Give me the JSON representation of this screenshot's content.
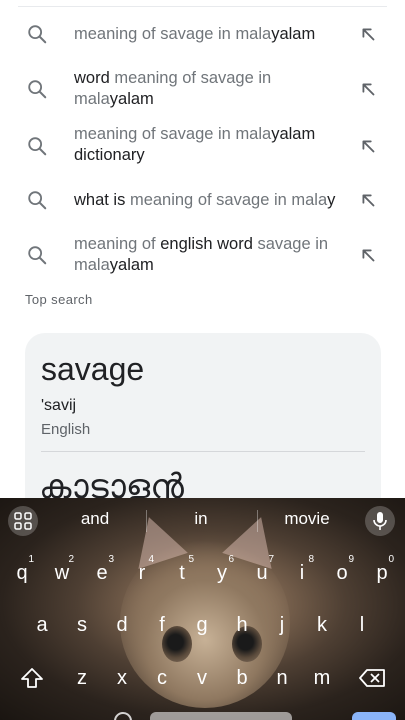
{
  "suggestions": [
    {
      "parts": [
        {
          "t": "meaning of savage in mala",
          "bold": false
        },
        {
          "t": "yalam",
          "bold": true
        }
      ]
    },
    {
      "parts": [
        {
          "t": "word",
          "bold": true
        },
        {
          "t": " meaning of savage in mala",
          "bold": false
        },
        {
          "t": "yalam",
          "bold": true
        }
      ]
    },
    {
      "parts": [
        {
          "t": "meaning of savage in mala",
          "bold": false
        },
        {
          "t": "yalam",
          "bold": true
        },
        {
          "t": " dictionary",
          "bold": true
        }
      ]
    },
    {
      "parts": [
        {
          "t": "what is",
          "bold": true
        },
        {
          "t": " meaning of savage in mala",
          "bold": false
        },
        {
          "t": "y",
          "bold": true
        }
      ]
    },
    {
      "parts": [
        {
          "t": "meaning of ",
          "bold": false
        },
        {
          "t": "english word",
          "bold": true
        },
        {
          "t": " savage in mala",
          "bold": false
        },
        {
          "t": "yalam",
          "bold": true
        }
      ]
    }
  ],
  "top_search_label": "Top search",
  "card": {
    "word": "savage",
    "phonetic": "'savij",
    "language": "English",
    "translation": "കാടാളൻ"
  },
  "keyboard": {
    "suggestions": [
      "and",
      "in",
      "movie"
    ],
    "row1": [
      {
        "k": "q",
        "n": "1"
      },
      {
        "k": "w",
        "n": "2"
      },
      {
        "k": "e",
        "n": "3"
      },
      {
        "k": "r",
        "n": "4"
      },
      {
        "k": "t",
        "n": "5"
      },
      {
        "k": "y",
        "n": "6"
      },
      {
        "k": "u",
        "n": "7"
      },
      {
        "k": "i",
        "n": "8"
      },
      {
        "k": "o",
        "n": "9"
      },
      {
        "k": "p",
        "n": "0"
      }
    ],
    "row2": [
      "a",
      "s",
      "d",
      "f",
      "g",
      "h",
      "j",
      "k",
      "l"
    ],
    "row3": [
      "z",
      "x",
      "c",
      "v",
      "b",
      "n",
      "m"
    ],
    "icons": {
      "grid": "apps-grid-icon",
      "mic": "microphone-icon",
      "shift": "shift-icon",
      "backspace": "backspace-icon"
    }
  },
  "colors": {
    "accent_blue": "#8ab4f8",
    "muted_text": "#70757a",
    "card_bg": "#f1f3f4"
  }
}
